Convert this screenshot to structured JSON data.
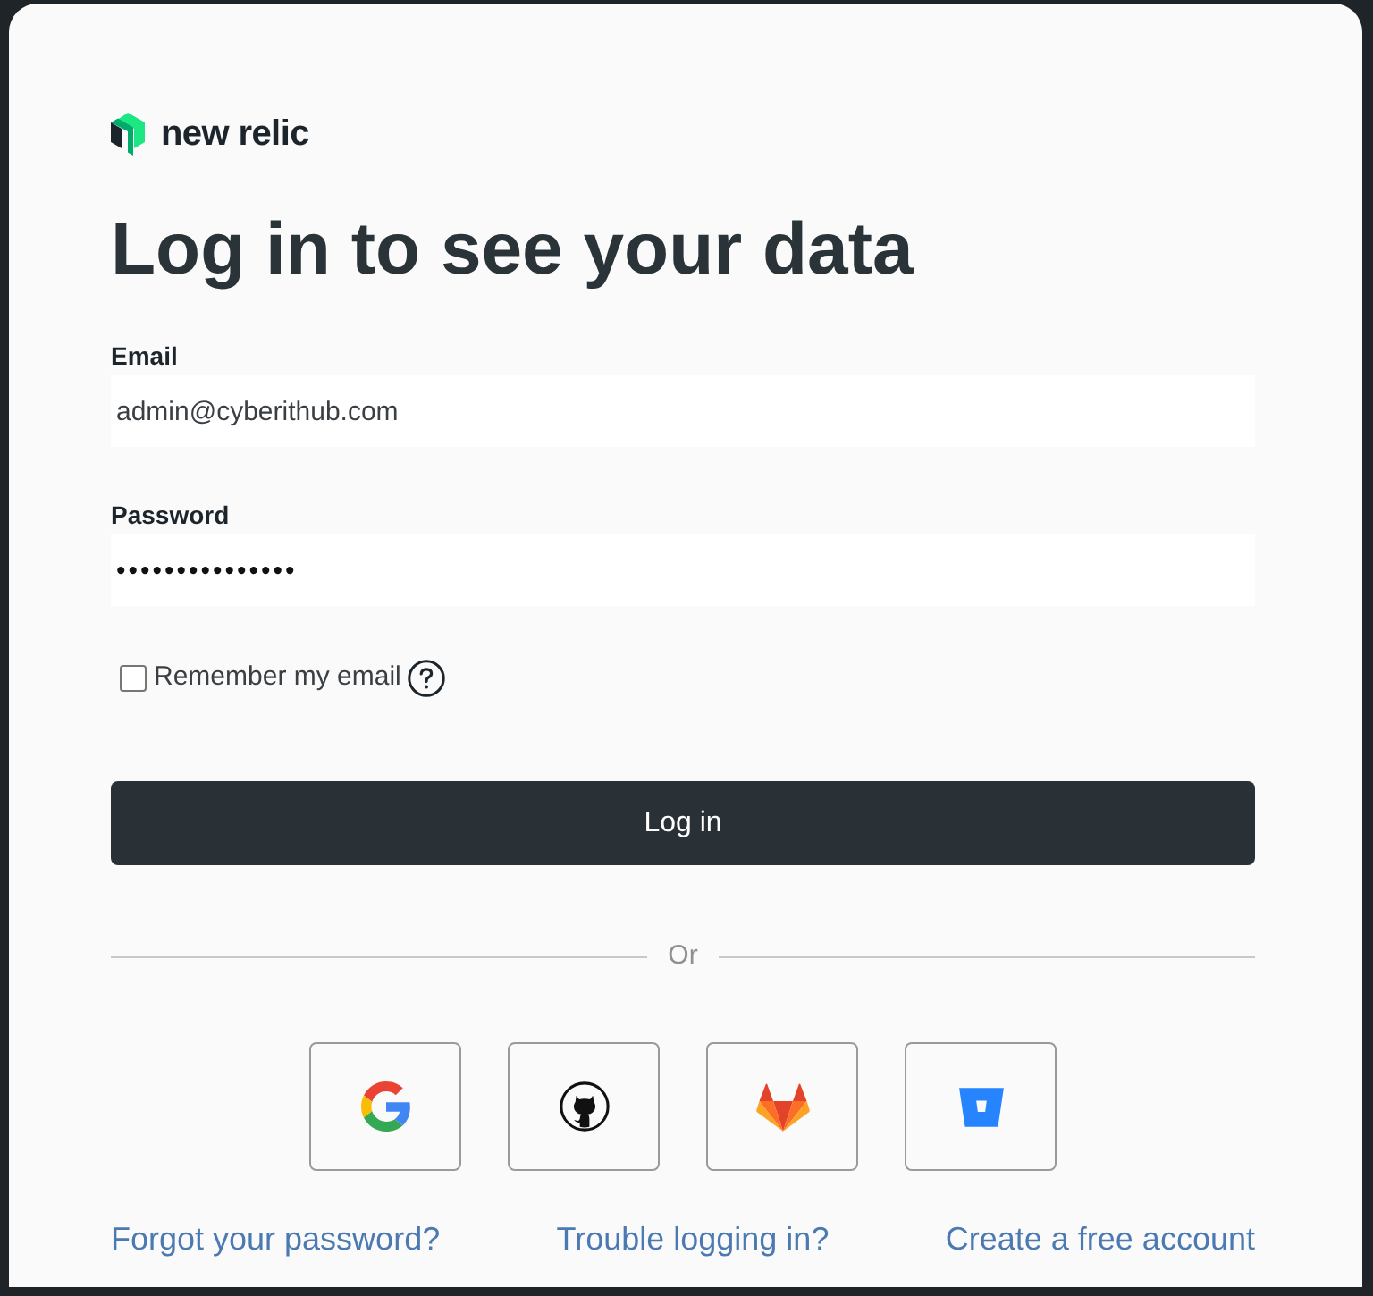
{
  "brand": {
    "name": "new relic"
  },
  "heading": "Log in to see your data",
  "form": {
    "fields": [
      {
        "kind": "text",
        "label": "Email",
        "value": "admin@cyberithub.com"
      },
      {
        "kind": "password",
        "label": "Password",
        "value": "•••••••••••••••"
      }
    ],
    "remember": {
      "label": "Remember my email",
      "checked": false
    },
    "submit": "Log in"
  },
  "divider": "Or",
  "social_logins": [
    {
      "kind": "google"
    },
    {
      "kind": "github"
    },
    {
      "kind": "gitlab"
    },
    {
      "kind": "bitbucket"
    }
  ],
  "links": [
    "Forgot your password?",
    "Trouble logging in?",
    "Create a free account"
  ]
}
